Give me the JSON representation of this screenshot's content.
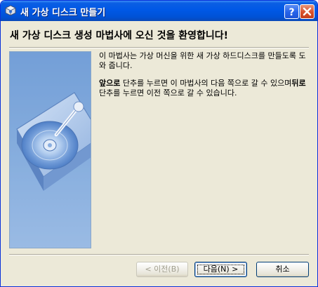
{
  "window": {
    "title": "새 가상 디스크 만들기",
    "title_icon": "virtualbox-icon",
    "help_button": "?",
    "close_button": "×"
  },
  "header": {
    "title": "새 가상 디스크 생성 마법사에 오신 것을 환영합니다!"
  },
  "side_image": {
    "icon": "hard-disk-icon"
  },
  "content": {
    "paragraph1": "이 마법사는 가상 머신을 위한 새 가상 하드디스크를 만들도록 도와 줍니다.",
    "paragraph2_prefix_bold": "앞으로",
    "paragraph2_mid": " 단추를 누르면 이 마법사의 다음 쪽으로 갈 수 있으며",
    "paragraph2_mid_bold": "뒤로",
    "paragraph2_suffix": " 단추를 누르면 이전 쪽으로 갈 수 있습니다."
  },
  "buttons": {
    "back": "< 이전(B)",
    "next": "다음(N) >",
    "cancel": "취소"
  },
  "colors": {
    "titlebar": "#0058e6",
    "window_bg": "#ece9d8",
    "close_button": "#d8502c"
  }
}
